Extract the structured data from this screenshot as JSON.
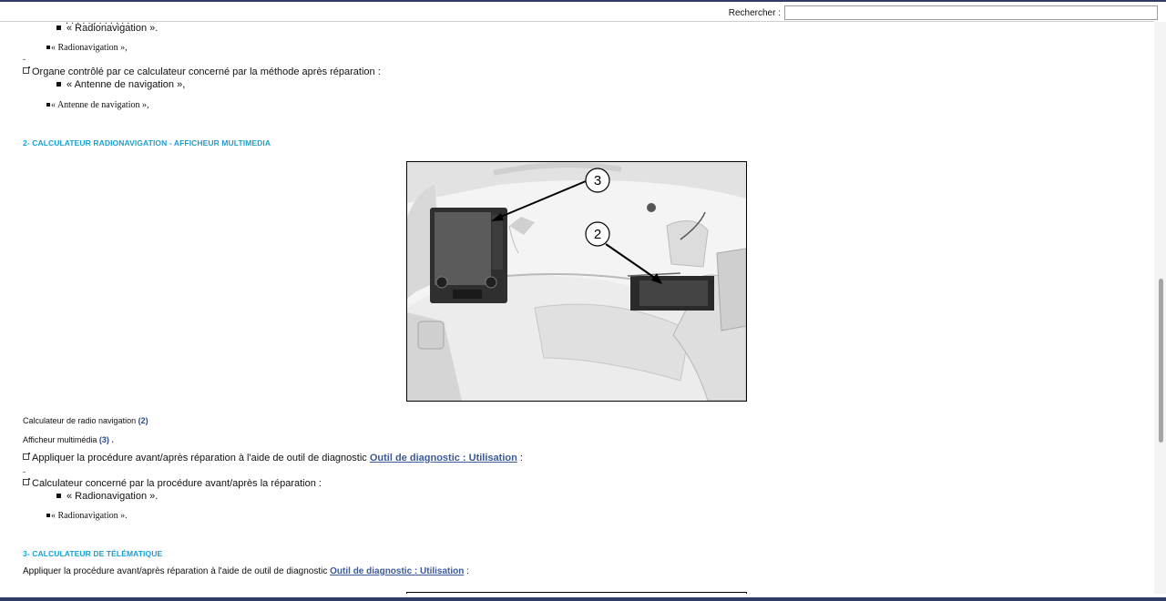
{
  "search": {
    "label": "Rechercher :",
    "value": ""
  },
  "top": {
    "radionav_bullet": "« Radionavigation ».",
    "radionav_serif": "« Radionavigation »,",
    "dash": "-",
    "organe": "Organe contrôlé par ce calculateur concerné par la méthode après réparation :",
    "antenne_bullet": "« Antenne de navigation »,",
    "antenne_serif": "« Antenne de navigation »,"
  },
  "section2": {
    "title": "2- CALCULATEUR RADIONAVIGATION - AFFICHEUR MULTIMEDIA",
    "figure_label_3": "3",
    "figure_label_2": "2",
    "calc_text": "Calculateur de radio navigation",
    "calc_ref_open": "(",
    "calc_ref": "2",
    "calc_ref_close": ")",
    "aff_text": "Afficheur multimédia",
    "aff_ref_open": "(",
    "aff_ref": "3",
    "aff_ref_close": ") .",
    "appliquer_text": "Appliquer la procédure avant/après réparation à l'aide de outil de diagnostic",
    "appliquer_link": "Outil de diagnostic : Utilisation",
    "appliquer_suffix": ":",
    "dash": "-",
    "calc_concerne": "Calculateur concerné par la procédure avant/après la réparation :",
    "radionav_bullet": "« Radionavigation ».",
    "radionav_serif": "« Radionavigation »."
  },
  "section3": {
    "title": "3- CALCULATEUR DE TÉLÉMATIQUE",
    "appliquer_text": "Appliquer la procédure avant/après réparation à l'aide de outil de diagnostic",
    "appliquer_link": "Outil de diagnostic : Utilisation",
    "appliquer_suffix": ":"
  }
}
